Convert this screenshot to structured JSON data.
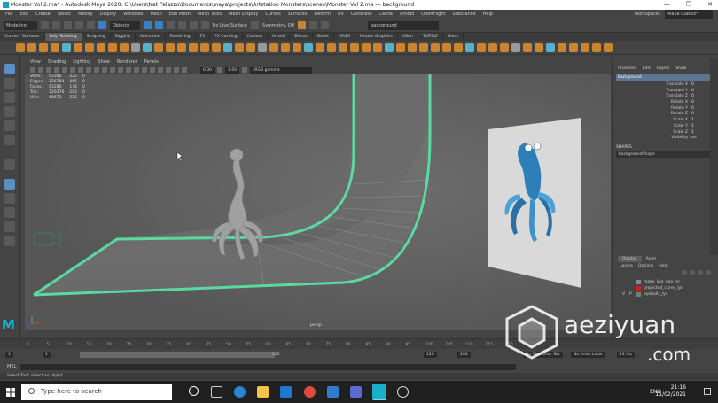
{
  "window": {
    "title": "Monster Vol 2.ma* - Autodesk Maya 2020: C:\\Users\\Nat Palazzo\\Documents\\maya\\projects\\Artstation Monsters\\scenes\\Monster Vol 2.ma --- background",
    "controls": [
      "—",
      "❐",
      "✕"
    ]
  },
  "menubar": {
    "items": [
      "File",
      "Edit",
      "Create",
      "Select",
      "Modify",
      "Display",
      "Windows",
      "Mesh",
      "Edit Mesh",
      "Mesh Tools",
      "Mesh Display",
      "Curves",
      "Surfaces",
      "Deform",
      "UV",
      "Generate",
      "Cache",
      "Arnold",
      "OpenFlight",
      "Substance",
      "Help"
    ],
    "workspace_label": "Workspace :",
    "workspace_value": "Maya Classic*"
  },
  "statusline": {
    "mode": "Modeling",
    "objects": "Objects",
    "live_surface": "No Live Surface",
    "symmetry": "Symmetry: Off",
    "search_value": "background"
  },
  "shelf": {
    "tabs": [
      "Curves / Surfaces",
      "Poly Modeling",
      "Sculpting",
      "Rigging",
      "Animation",
      "Rendering",
      "FX",
      "FX Caching",
      "Custom",
      "Arnold",
      "Bifrost",
      "Bullet",
      "MASH",
      "Motion Graphics",
      "XGen",
      "TURTLE",
      "Glass"
    ],
    "active_tab": "Poly Modeling"
  },
  "viewport": {
    "menu": [
      "View",
      "Shading",
      "Lighting",
      "Show",
      "Renderer",
      "Panels"
    ],
    "near_value": "0.00",
    "far_value": "1.00",
    "color_space": "sRGB gamma",
    "camera_label": "persp",
    "hud": {
      "rows": [
        {
          "label": "Verts:",
          "a": "63366",
          "b": "225",
          "c": "0"
        },
        {
          "label": "Edges:",
          "a": "126784",
          "b": "465",
          "c": "0"
        },
        {
          "label": "Faces:",
          "a": "63280",
          "b": "176",
          "c": "0"
        },
        {
          "label": "Tris:",
          "a": "126376",
          "b": "292",
          "c": "0"
        },
        {
          "label": "UVs:",
          "a": "68673",
          "b": "225",
          "c": "0"
        }
      ]
    }
  },
  "channel_box": {
    "menus": [
      "Channels",
      "Edit",
      "Object",
      "Show"
    ],
    "object_name": "background",
    "attributes": [
      {
        "name": "Translate X",
        "value": "0"
      },
      {
        "name": "Translate Y",
        "value": "0"
      },
      {
        "name": "Translate Z",
        "value": "0"
      },
      {
        "name": "Rotate X",
        "value": "0"
      },
      {
        "name": "Rotate Y",
        "value": "0"
      },
      {
        "name": "Rotate Z",
        "value": "0"
      },
      {
        "name": "Scale X",
        "value": "1"
      },
      {
        "name": "Scale Y",
        "value": "1"
      },
      {
        "name": "Scale Z",
        "value": "1"
      },
      {
        "name": "Visibility",
        "value": "on"
      }
    ],
    "shapes_label": "SHAPES",
    "shape_name": "backgroundShape"
  },
  "layers": {
    "tabs": [
      "Display",
      "Anim"
    ],
    "active_tab": "Display",
    "menus": [
      "Layers",
      "Options",
      "Help"
    ],
    "rows": [
      {
        "v": "",
        "p": "",
        "name": "make_live_geo_lyr",
        "color": "#8a8a8a"
      },
      {
        "v": "",
        "p": "",
        "name": "projected_curve_lyr",
        "color": "#cc2020"
      },
      {
        "v": "V",
        "p": "P",
        "name": "eyeballs_lyr",
        "color": "#7a7a7a"
      }
    ]
  },
  "timeline": {
    "ticks": [
      "1",
      "5",
      "10",
      "15",
      "20",
      "25",
      "30",
      "35",
      "40",
      "45",
      "50",
      "55",
      "60",
      "65",
      "70",
      "75",
      "80",
      "85",
      "90",
      "95",
      "100",
      "105",
      "110",
      "115",
      "120"
    ],
    "range_start": "1",
    "range_start2": "1",
    "range_end_inner": "120",
    "range_end": "120",
    "range_end2": "200",
    "character_set": "No Character Set",
    "anim_layer": "No Anim Layer",
    "fps": "24 fps"
  },
  "command_line": {
    "language": "MEL",
    "help_text": "Select Tool: select an object"
  },
  "taskbar": {
    "search_placeholder": "Type here to search",
    "language": "ENG",
    "time": "21:16",
    "date": "11/02/2021"
  },
  "watermark": {
    "text": "aeziyuan",
    "sub": ".com"
  },
  "colors": {
    "accent": "#5ad9a0",
    "maya_teal": "#1ab0c9",
    "viewport_bg": "#5d5d5d",
    "selected_blue": "#5d7591"
  }
}
